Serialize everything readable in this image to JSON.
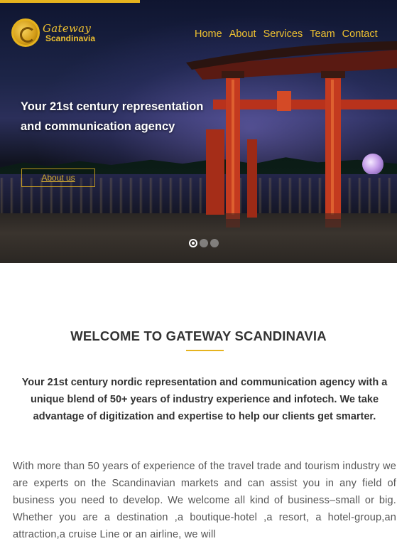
{
  "brand": {
    "logo_line1": "Gateway",
    "logo_line2": "Scandinavia",
    "accent_color": "#e6b31e"
  },
  "nav": {
    "items": [
      "Home",
      "About",
      "Services",
      "Team",
      "Contact"
    ]
  },
  "hero": {
    "caption_line1": "Your 21st century representation",
    "caption_line2": "and communication agency",
    "button_label": "About us",
    "slide_count": 3,
    "active_slide": 1
  },
  "welcome": {
    "heading": "WELCOME TO GATEWAY SCANDINAVIA",
    "intro": "Your 21st century nordic representation and communication agency with a unique blend of 50+ years of industry experience and infotech. We take advantage of digitization and expertise to help our clients get smarter.",
    "body": "With more than 50 years of experience of the travel trade and tourism industry we are experts on the Scandinavian markets and can assist you in any field of business you need to develop. We welcome all kind of business–small or big. Whether you are a destination ,a boutique-hotel ,a resort, a hotel-group,an attraction,a cruise Line or an airline, we will"
  }
}
